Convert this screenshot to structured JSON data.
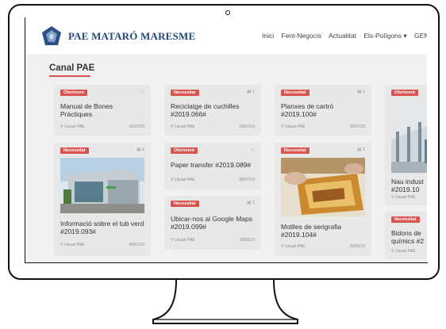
{
  "site": {
    "logo_text": "PAE MATARÓ MARESME"
  },
  "nav": [
    "Inici",
    "Fent-Negocis",
    "Actualitat",
    "Els-Polígons ▾",
    "GEN"
  ],
  "section_title": "Canal PAE",
  "cards": [
    {
      "badge": "Oferiment",
      "comments": "",
      "title": "Manual de Bones Pràctiques",
      "user": "Usuari PAE",
      "date": "16/07/19"
    },
    {
      "badge": "Necessitat",
      "comments": "1",
      "title": "Informació sobre el tub verd #2019.093#",
      "user": "Usuari PAE",
      "date": "08/07/19",
      "comments_count": "2"
    },
    {
      "badge": "Necessitat",
      "comments": "1",
      "title": "Reciclatge de cuchilles #2019.066#",
      "user": "Usuari PAE",
      "date": "16/07/19"
    },
    {
      "badge": "Oferiment",
      "comments": "",
      "title": "Paper transfer #2019.089#",
      "user": "Usuari PAE",
      "date": "08/07/19"
    },
    {
      "badge": "Necessitat",
      "comments": "1",
      "title": "Ubicar-nos al Google Maps #2019.099#",
      "user": "Usuari PAE",
      "date": "18/06/19"
    },
    {
      "badge": "Necessitat",
      "comments": "1",
      "title": "Planxes de cartró #2019.100#",
      "user": "Usuari PAE",
      "date": "15/07/19"
    },
    {
      "badge": "Necessitat",
      "comments": "1",
      "title": "Motlles de serigrafia #2019.104#",
      "user": "Usuari PAE",
      "date": "26/06/19"
    },
    {
      "badge": "Oferiment",
      "comments": "",
      "title": "Nau indust #2019.10",
      "user": "Usuari PAE",
      "date": ""
    },
    {
      "badge": "Necessitat",
      "comments": "",
      "title": "Bidons de químics #2",
      "user": "Usuari PAE",
      "date": ""
    }
  ],
  "colors": {
    "badge": "#d9534f",
    "logo": "#24477a"
  }
}
